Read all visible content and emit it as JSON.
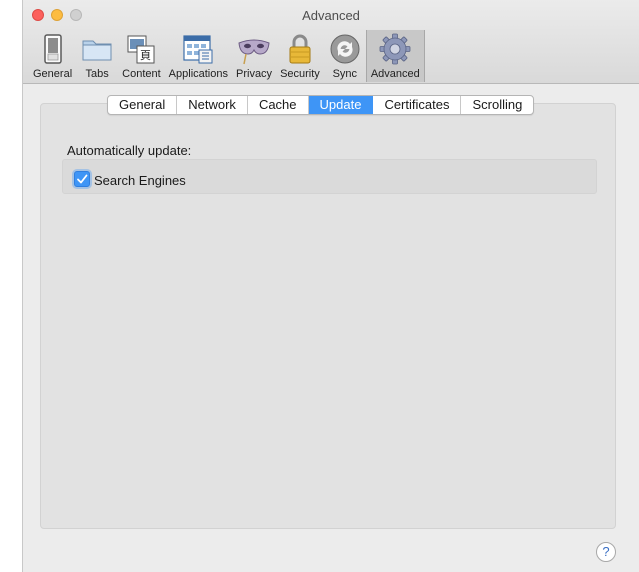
{
  "window": {
    "title": "Advanced"
  },
  "toolbar": {
    "items": [
      {
        "label": "General",
        "icon": "switch-icon"
      },
      {
        "label": "Tabs",
        "icon": "folder-icon"
      },
      {
        "label": "Content",
        "icon": "content-icon"
      },
      {
        "label": "Applications",
        "icon": "applications-icon"
      },
      {
        "label": "Privacy",
        "icon": "mask-icon"
      },
      {
        "label": "Security",
        "icon": "lock-icon"
      },
      {
        "label": "Sync",
        "icon": "sync-icon"
      },
      {
        "label": "Advanced",
        "icon": "gear-icon"
      }
    ],
    "active": "Advanced"
  },
  "tabs": [
    "General",
    "Network",
    "Cache",
    "Update",
    "Certificates",
    "Scrolling"
  ],
  "selected_tab": "Update",
  "update": {
    "section_label": "Automatically update:",
    "option_label": "Search Engines",
    "option_checked": true
  },
  "help": {
    "label": "?"
  },
  "colors": {
    "accent": "#3e95f6",
    "close": "#fc605c",
    "minimize": "#fdbc40"
  }
}
